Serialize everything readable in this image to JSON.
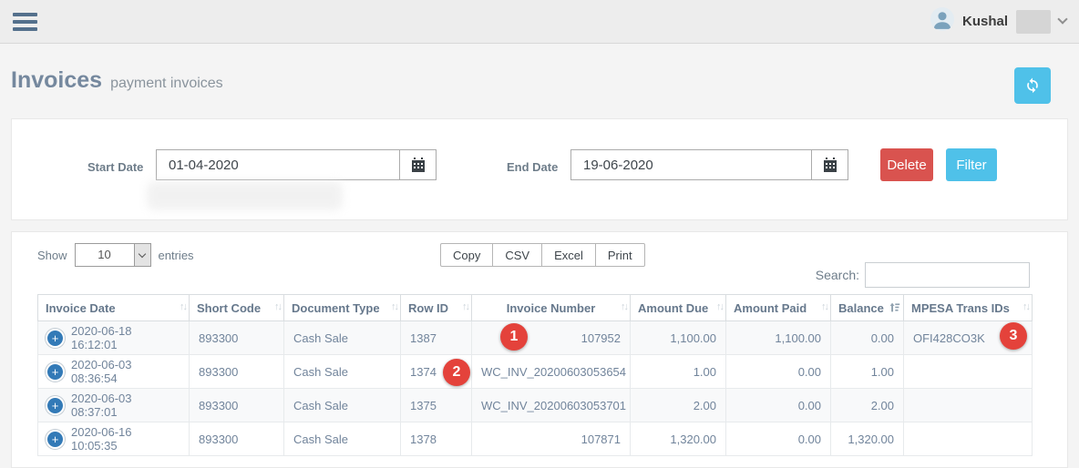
{
  "topbar": {
    "user_name": "Kushal"
  },
  "page_header": {
    "title": "Invoices",
    "subtitle": "payment invoices"
  },
  "filters": {
    "start_date_label": "Start Date",
    "start_date_value": "01-04-2020",
    "end_date_label": "End Date",
    "end_date_value": "19-06-2020",
    "delete_button": "Delete",
    "filter_button": "Filter"
  },
  "table_controls": {
    "show_label": "Show",
    "page_length": "10",
    "entries_label": "entries",
    "export_buttons": {
      "copy": "Copy",
      "csv": "CSV",
      "excel": "Excel",
      "print": "Print"
    },
    "search_label": "Search:",
    "search_value": ""
  },
  "table": {
    "columns": {
      "invoice_date": "Invoice Date",
      "short_code": "Short Code",
      "document_type": "Document Type",
      "row_id": "Row ID",
      "invoice_number": "Invoice Number",
      "amount_due": "Amount Due",
      "amount_paid": "Amount Paid",
      "balance": "Balance",
      "mpesa_trans_ids": "MPESA Trans IDs"
    },
    "rows": [
      {
        "invoice_date": "2020-06-18 16:12:01",
        "short_code": "893300",
        "document_type": "Cash Sale",
        "row_id": "1387",
        "invoice_number": "107952",
        "amount_due": "1,100.00",
        "amount_paid": "1,100.00",
        "balance": "0.00",
        "mpesa_trans_ids": "OFI428CO3K"
      },
      {
        "invoice_date": "2020-06-03 08:36:54",
        "short_code": "893300",
        "document_type": "Cash Sale",
        "row_id": "1374",
        "invoice_number": "WC_INV_20200603053654",
        "amount_due": "1.00",
        "amount_paid": "0.00",
        "balance": "1.00",
        "mpesa_trans_ids": ""
      },
      {
        "invoice_date": "2020-06-03 08:37:01",
        "short_code": "893300",
        "document_type": "Cash Sale",
        "row_id": "1375",
        "invoice_number": "WC_INV_20200603053701",
        "amount_due": "2.00",
        "amount_paid": "0.00",
        "balance": "2.00",
        "mpesa_trans_ids": ""
      },
      {
        "invoice_date": "2020-06-16 10:05:35",
        "short_code": "893300",
        "document_type": "Cash Sale",
        "row_id": "1378",
        "invoice_number": "107871",
        "amount_due": "1,320.00",
        "amount_paid": "0.00",
        "balance": "1,320.00",
        "mpesa_trans_ids": ""
      }
    ],
    "expand_symbol": "+",
    "sort_symbol": "↑↓"
  },
  "annotations": [
    {
      "label": "1"
    },
    {
      "label": "2"
    },
    {
      "label": "3"
    }
  ],
  "icons": {
    "menu": "hamburger-icon",
    "avatar": "user-avatar-icon",
    "caret": "chevron-down-icon",
    "refresh": "refresh-icon",
    "calendar": "calendar-icon",
    "expand_row": "plus-circle-icon",
    "sort_inactive": "sort-arrows-icon",
    "sort_active": "sort-amount-icon"
  },
  "colors": {
    "accent": "#4fc1e9",
    "danger": "#d9534f",
    "annotation_red": "#e4423b",
    "expand_blue": "#337ab7",
    "heading": "#75889e"
  }
}
